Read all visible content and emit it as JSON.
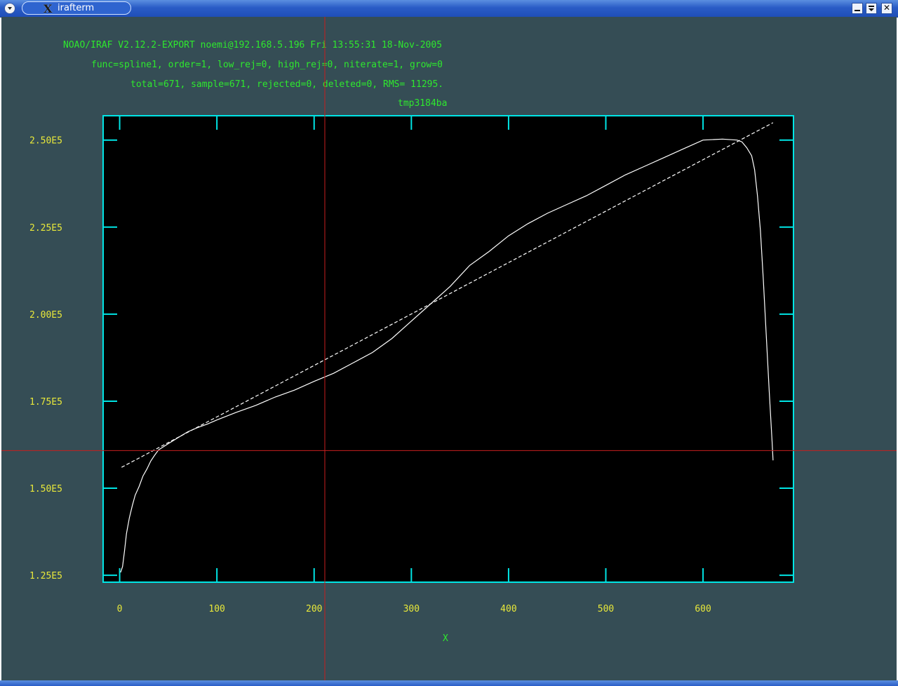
{
  "window": {
    "title": "irafterm",
    "title_icon": "x-icon",
    "buttons": [
      "minimize-icon",
      "shade-icon",
      "close-icon"
    ]
  },
  "header": {
    "line1": "NOAO/IRAF V2.12.2-EXPORT noemi@192.168.5.196 Fri 13:55:31 18-Nov-2005",
    "line2": "func=spline1, order=1, low_rej=0, high_rej=0, niterate=1, grow=0",
    "line3": "total=671, sample=671, rejected=0, deleted=0, RMS= 11295.",
    "line4": "tmp3184ba"
  },
  "colors": {
    "background": "#354d55",
    "plot_bg": "#000000",
    "axes": "#00e5e5",
    "header_text": "#2ee82e",
    "tick_labels": "#e8e83a",
    "data_line": "#ffffff",
    "cursor": "#c81e1e"
  },
  "chart_data": {
    "type": "line",
    "title": "tmp3184ba",
    "xlabel": "X",
    "ylabel": "",
    "xlim": [
      -17,
      693
    ],
    "ylim": [
      123000,
      257000
    ],
    "x_ticks": [
      0,
      100,
      200,
      300,
      400,
      500,
      600
    ],
    "x_tick_labels": [
      "0",
      "100",
      "200",
      "300",
      "400",
      "500",
      "600"
    ],
    "y_ticks": [
      125000,
      150000,
      175000,
      200000,
      225000,
      250000
    ],
    "y_tick_labels": [
      "1.25E5",
      "1.50E5",
      "1.75E5",
      "2.00E5",
      "2.25E5",
      "2.50E5"
    ],
    "grid": false,
    "cursor": {
      "x": 211,
      "y": 160800
    },
    "series": [
      {
        "style": "solid",
        "points": [
          [
            1,
            125800
          ],
          [
            3,
            127500
          ],
          [
            5,
            132000
          ],
          [
            7,
            137000
          ],
          [
            10,
            141500
          ],
          [
            13,
            145000
          ],
          [
            16,
            148000
          ],
          [
            20,
            150500
          ],
          [
            24,
            153500
          ],
          [
            28,
            155500
          ],
          [
            32,
            157800
          ],
          [
            36,
            159500
          ],
          [
            40,
            161000
          ],
          [
            50,
            162800
          ],
          [
            60,
            164500
          ],
          [
            70,
            166200
          ],
          [
            80,
            167400
          ],
          [
            90,
            168400
          ],
          [
            100,
            169600
          ],
          [
            120,
            171800
          ],
          [
            140,
            173800
          ],
          [
            160,
            176200
          ],
          [
            180,
            178200
          ],
          [
            200,
            180700
          ],
          [
            220,
            183000
          ],
          [
            240,
            186000
          ],
          [
            260,
            189000
          ],
          [
            280,
            193000
          ],
          [
            300,
            198000
          ],
          [
            320,
            203000
          ],
          [
            340,
            208000
          ],
          [
            360,
            214000
          ],
          [
            380,
            218000
          ],
          [
            400,
            222500
          ],
          [
            420,
            226000
          ],
          [
            440,
            229000
          ],
          [
            460,
            231500
          ],
          [
            480,
            234000
          ],
          [
            500,
            237000
          ],
          [
            520,
            240000
          ],
          [
            540,
            242500
          ],
          [
            560,
            245000
          ],
          [
            580,
            247500
          ],
          [
            600,
            250000
          ],
          [
            620,
            250300
          ],
          [
            635,
            250000
          ],
          [
            640,
            249500
          ],
          [
            645,
            247800
          ],
          [
            650,
            245500
          ],
          [
            653,
            241500
          ],
          [
            656,
            234000
          ],
          [
            659,
            224000
          ],
          [
            662,
            210000
          ],
          [
            665,
            194000
          ],
          [
            668,
            178000
          ],
          [
            671,
            163500
          ],
          [
            672,
            158000
          ]
        ]
      },
      {
        "style": "dashed",
        "points": [
          [
            2,
            156000
          ],
          [
            672,
            255000
          ]
        ]
      }
    ]
  }
}
